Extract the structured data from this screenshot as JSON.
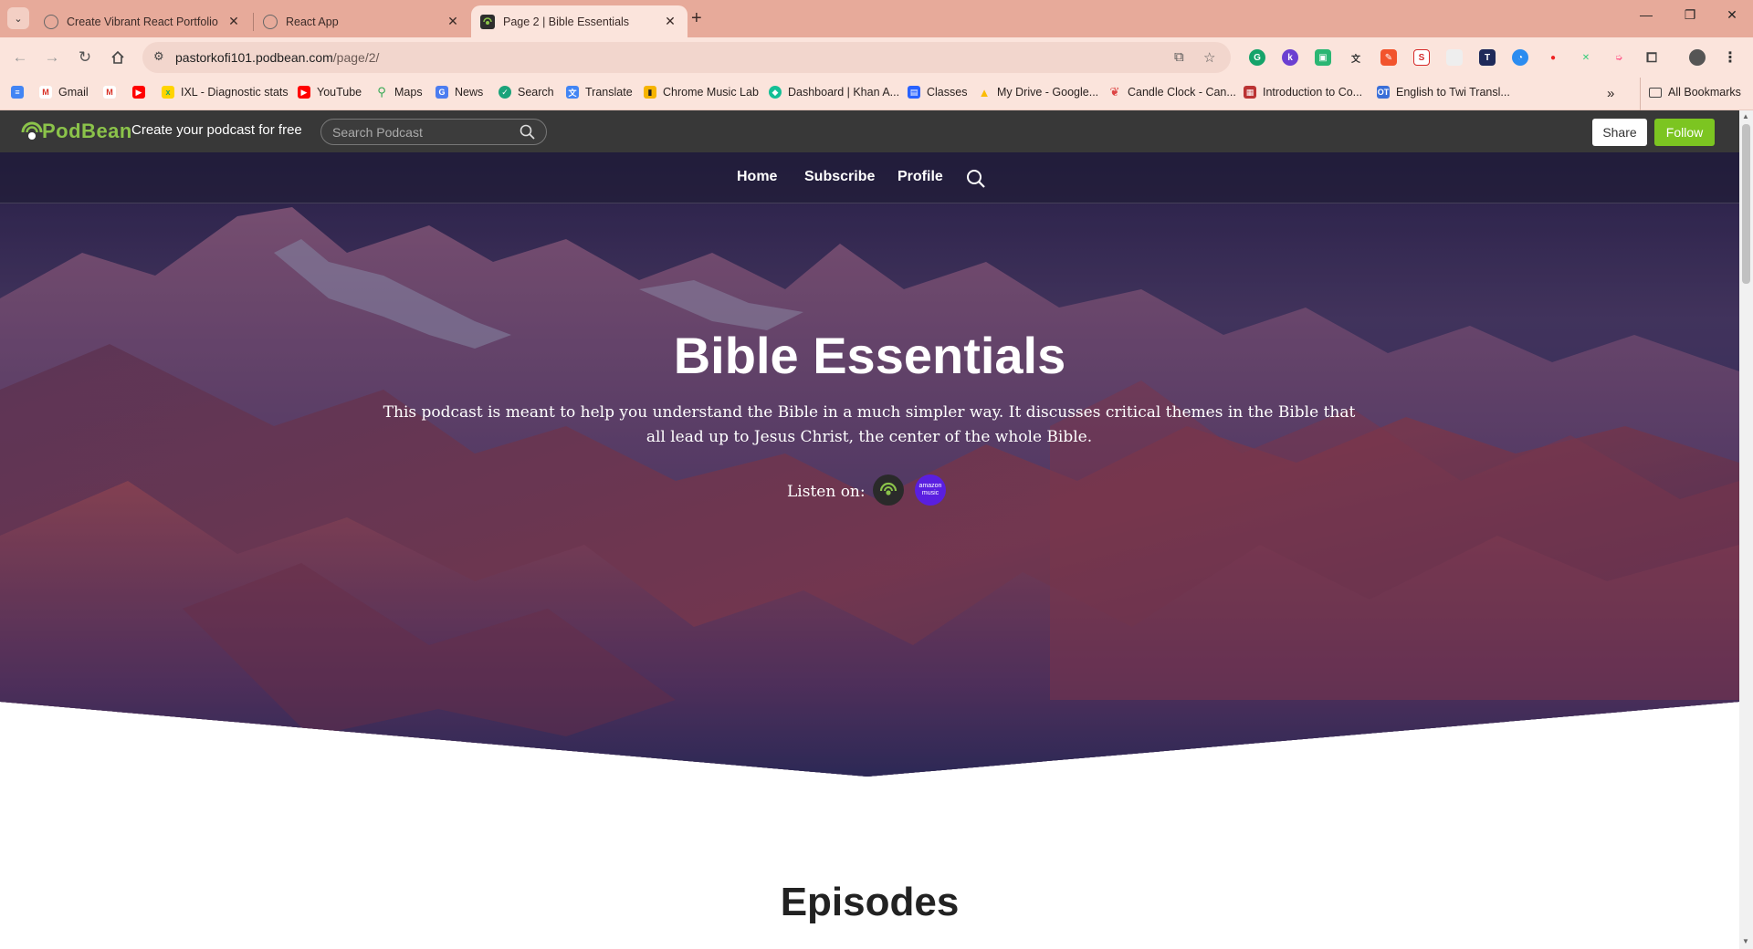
{
  "browser": {
    "tabs": [
      {
        "title": "Create Vibrant React Portfolio",
        "active": false
      },
      {
        "title": "React App",
        "active": false
      },
      {
        "title": "Page 2 | Bible Essentials",
        "active": true
      }
    ],
    "new_tab": "+",
    "address": {
      "host": "pastorkofi101.podbean.com",
      "path": "/page/2/"
    },
    "bookmarks": [
      {
        "label": "Gmail",
        "icon": "gmail-icon"
      },
      {
        "label": "",
        "icon": "gmail-icon"
      },
      {
        "label": "",
        "icon": "youtube-icon"
      },
      {
        "label": "IXL - Diagnostic stats",
        "icon": "ixl-icon"
      },
      {
        "label": "YouTube",
        "icon": "youtube-icon"
      },
      {
        "label": "Maps",
        "icon": "maps-icon"
      },
      {
        "label": "News",
        "icon": "news-icon"
      },
      {
        "label": "Search",
        "icon": "search-icon"
      },
      {
        "label": "Translate",
        "icon": "translate-icon"
      },
      {
        "label": "Chrome Music Lab",
        "icon": "music-lab-icon"
      },
      {
        "label": "Dashboard | Khan A...",
        "icon": "khan-icon"
      },
      {
        "label": "Classes",
        "icon": "classes-icon"
      },
      {
        "label": "My Drive - Google...",
        "icon": "drive-icon"
      },
      {
        "label": "Candle Clock - Can...",
        "icon": "candle-icon"
      },
      {
        "label": "Introduction to Co...",
        "icon": "intro-icon"
      },
      {
        "label": "English to Twi Transl...",
        "icon": "twi-icon"
      }
    ],
    "more_bookmarks": "»",
    "all_bookmarks": "All Bookmarks"
  },
  "podbean": {
    "logo_text": "PodBean",
    "create_text": "Create your podcast for free",
    "search_placeholder": "Search Podcast",
    "share_label": "Share",
    "follow_label": "Follow"
  },
  "hero": {
    "nav": [
      "Home",
      "Subscribe",
      "Profile"
    ],
    "title": "Bible Essentials",
    "description": "This podcast is meant to help you understand the Bible in a much simpler way. It discusses critical themes in the Bible that all lead up to Jesus Christ, the center of the whole Bible.",
    "listen_label": "Listen on:",
    "platforms": [
      {
        "name": "podbean-app-icon",
        "text": ""
      },
      {
        "name": "amazon-music-icon",
        "text": "amazon music"
      }
    ]
  },
  "episodes": {
    "title": "Episodes"
  },
  "colors": {
    "tabbar": "#e7aa9a",
    "toolbar": "#fbe4dc",
    "podbean_header": "#383838",
    "follow_green": "#7cc521",
    "logo_green": "#8bc34a",
    "amazon_purple": "#5a1fe0"
  }
}
